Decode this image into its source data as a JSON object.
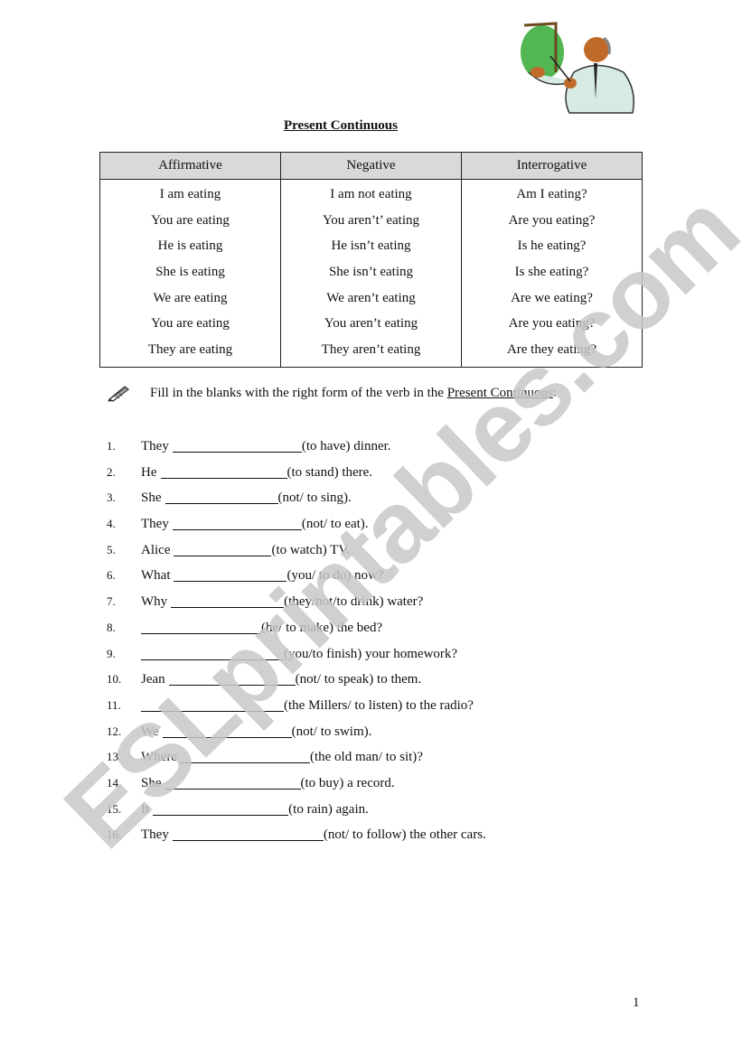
{
  "title": "Present Continuous",
  "table": {
    "headers": [
      "Affirmative",
      "Negative",
      "Interrogative"
    ],
    "rows": [
      [
        "I am eating",
        "I am not eating",
        "Am I eating?"
      ],
      [
        "You are eating",
        "You aren’t’ eating",
        "Are you eating?"
      ],
      [
        "He is eating",
        "He isn’t eating",
        "Is he eating?"
      ],
      [
        "She is eating",
        "She isn’t eating",
        "Is she eating?"
      ],
      [
        "We are eating",
        "We aren’t eating",
        "Are we eating?"
      ],
      [
        "You are eating",
        "You aren’t eating",
        "Are you eating?"
      ],
      [
        "They are eating",
        "They aren’t eating",
        "Are they eating?"
      ]
    ]
  },
  "instruction": {
    "icon": "pencil-icon",
    "text": "Fill in the blanks with the right form of the verb in the ",
    "underlined": "Present Continuous",
    "trailing": ":"
  },
  "exercises": [
    {
      "num": "1.",
      "subject": "They",
      "hint": "(to have) dinner."
    },
    {
      "num": "2.",
      "subject": "He",
      "hint": "(to stand) there."
    },
    {
      "num": "3.",
      "subject": "She",
      "hint": "(not/ to sing)."
    },
    {
      "num": "4.",
      "subject": "They",
      "hint": "(not/ to eat)."
    },
    {
      "num": "5.",
      "subject": "Alice",
      "hint": "(to watch) TV."
    },
    {
      "num": "6.",
      "subject": "What",
      "hint": "(you/ to do) now?"
    },
    {
      "num": "7.",
      "subject": "Why",
      "hint": "(they/not/to drink) water?"
    },
    {
      "num": "8.",
      "subject": "",
      "hint": "(he/ to make) the bed?"
    },
    {
      "num": "9.",
      "subject": "",
      "hint": "(you/to finish) your homework?"
    },
    {
      "num": "10.",
      "subject": "Jean",
      "hint": "(not/ to speak) to them."
    },
    {
      "num": "11.",
      "subject": "",
      "hint": "(the Millers/ to listen) to the radio?"
    },
    {
      "num": "12.",
      "subject": "We",
      "hint": "(not/ to swim)."
    },
    {
      "num": "13.",
      "subject": "Where",
      "hint": "(the old man/ to sit)?"
    },
    {
      "num": "14.",
      "subject": "She",
      "hint": "(to buy) a record."
    },
    {
      "num": "15.",
      "subject": "It",
      "hint": "(to rain) again."
    },
    {
      "num": "16.",
      "subject": "They",
      "hint": "(not/ to follow) the other cars."
    }
  ],
  "page_number": "1",
  "watermark": "ESLprintables.com",
  "colors": {
    "header_fill": "#d9d9d9",
    "watermark": "#c8c8c8",
    "board_green": "#3fae3f"
  }
}
